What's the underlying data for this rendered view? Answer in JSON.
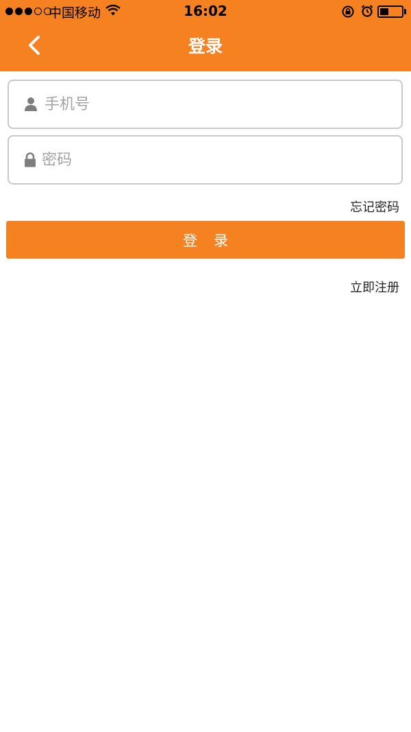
{
  "status_bar": {
    "carrier": "中国移动",
    "time": "16:02",
    "battery_level": 0.4
  },
  "header": {
    "title": "登录",
    "back_icon": "chevron-left-icon"
  },
  "form": {
    "phone": {
      "placeholder": "手机号",
      "value": "",
      "icon": "user-icon"
    },
    "password": {
      "placeholder": "密码",
      "value": "",
      "icon": "lock-icon"
    },
    "forgot_label": "忘记密码",
    "submit_label": "登录",
    "register_label": "立即注册"
  },
  "colors": {
    "accent": "#f58121",
    "field_border": "#c9c9c9",
    "placeholder": "#a3a3a3"
  }
}
